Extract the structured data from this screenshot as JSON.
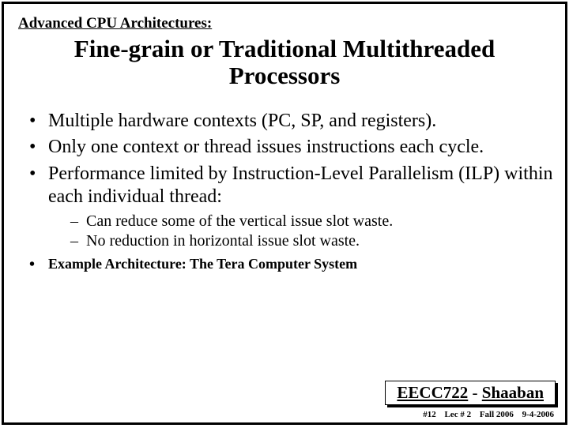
{
  "kicker": "Advanced CPU Architectures:",
  "title_line1": "Fine-grain or Traditional Multithreaded",
  "title_line2": "Processors",
  "bullets": {
    "b1": "Multiple hardware contexts (PC, SP, and registers).",
    "b2": "Only one context or thread issues instructions each cycle.",
    "b3": "Performance limited by Instruction-Level Parallelism (ILP) within each individual  thread:",
    "b3_sub1": "Can reduce some of the vertical issue slot waste.",
    "b3_sub2": "No reduction in horizontal issue slot waste."
  },
  "example": "Example Architecture:  The Tera Computer System",
  "footer": {
    "course": "EECC722",
    "dash": " - ",
    "author": "Shaaban"
  },
  "footline": {
    "slide_no": "#12",
    "lecture": "Lec # 2",
    "term": "Fall 2006",
    "date": "9-4-2006"
  }
}
